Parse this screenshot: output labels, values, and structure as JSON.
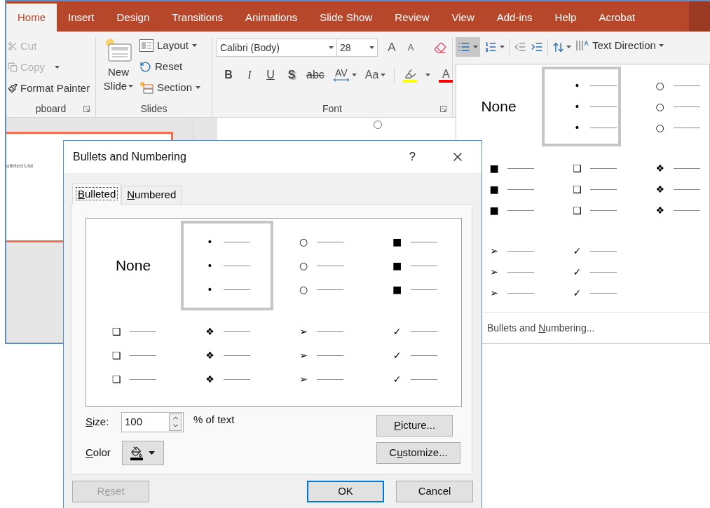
{
  "ribbon": {
    "tabs": [
      {
        "label": "Home",
        "selected": true
      },
      {
        "label": "Insert",
        "selected": false
      },
      {
        "label": "Design",
        "selected": false
      },
      {
        "label": "Transitions",
        "selected": false
      },
      {
        "label": "Animations",
        "selected": false
      },
      {
        "label": "Slide Show",
        "selected": false
      },
      {
        "label": "Review",
        "selected": false
      },
      {
        "label": "View",
        "selected": false
      },
      {
        "label": "Add-ins",
        "selected": false
      },
      {
        "label": "Help",
        "selected": false
      },
      {
        "label": "Acrobat",
        "selected": false
      }
    ],
    "clipboard": {
      "label": "pboard",
      "items": [
        {
          "label": "Cut",
          "kind": "cut",
          "disabled": true,
          "dropdown": false
        },
        {
          "label": "Copy",
          "kind": "copy",
          "disabled": true,
          "dropdown": true
        },
        {
          "label": "Format Painter",
          "kind": "painter",
          "disabled": false,
          "dropdown": false
        }
      ]
    },
    "slides": {
      "label": "Slides",
      "new_slide": [
        "New",
        "Slide"
      ],
      "items": [
        {
          "label": "Layout",
          "kind": "layout",
          "dropdown": true
        },
        {
          "label": "Reset",
          "kind": "reset",
          "dropdown": false
        },
        {
          "label": "Section",
          "kind": "section",
          "dropdown": true
        }
      ]
    },
    "font": {
      "label": "Font",
      "font_name": "Calibri (Body)",
      "font_size": "28",
      "grow": "A",
      "shrink": "A",
      "styles": [
        {
          "label": "B",
          "kind": "bold"
        },
        {
          "label": "I",
          "kind": "italic"
        },
        {
          "label": "U",
          "kind": "underline"
        },
        {
          "label": "S",
          "kind": "shadow"
        },
        {
          "label": "abc",
          "kind": "strike"
        }
      ],
      "spacing": "AV",
      "case": "Aa",
      "font_color": "A"
    },
    "paragraph": {
      "bullets_selected": true,
      "text_direction": "Text Direction"
    }
  },
  "slide_thumbnail": {
    "text": "ulleted List"
  },
  "gallery": {
    "cells": [
      {
        "kind": "none",
        "label": "None",
        "selected": false
      },
      {
        "kind": "bullets",
        "symbol": "•",
        "selected": true
      },
      {
        "kind": "bullets",
        "symbol": "○",
        "selected": false
      },
      {
        "kind": "bullets",
        "symbol": "■",
        "selected": false
      },
      {
        "kind": "bullets",
        "symbol": "❑",
        "selected": false
      },
      {
        "kind": "bullets",
        "symbol": "❖",
        "selected": false
      },
      {
        "kind": "bullets",
        "symbol": "➢",
        "selected": false
      },
      {
        "kind": "bullets",
        "symbol": "✓",
        "selected": false
      }
    ],
    "footer": {
      "parts": [
        {
          "text": "Bullets and ",
          "underline": false
        },
        {
          "text": "N",
          "underline": true
        },
        {
          "text": "umbering...",
          "underline": false
        }
      ]
    }
  },
  "dialog": {
    "title": "Bullets and Numbering",
    "help": "?",
    "tabs": [
      {
        "parts": [
          {
            "text": "B",
            "underline": true
          },
          {
            "text": "ulleted",
            "underline": false
          }
        ],
        "selected": true
      },
      {
        "parts": [
          {
            "text": "N",
            "underline": true
          },
          {
            "text": "umbered",
            "underline": false
          }
        ],
        "selected": false
      }
    ],
    "cells": [
      {
        "kind": "none",
        "label": "None",
        "selected": false
      },
      {
        "kind": "bullets",
        "symbol": "•",
        "selected": true
      },
      {
        "kind": "bullets",
        "symbol": "○",
        "selected": false
      },
      {
        "kind": "bullets",
        "symbol": "■",
        "selected": false
      },
      {
        "kind": "bullets",
        "symbol": "❑",
        "selected": false
      },
      {
        "kind": "bullets",
        "symbol": "❖",
        "selected": false
      },
      {
        "kind": "bullets",
        "symbol": "➢",
        "selected": false
      },
      {
        "kind": "bullets",
        "symbol": "✓",
        "selected": false
      }
    ],
    "size": {
      "parts": [
        {
          "text": "S",
          "underline": true
        },
        {
          "text": "ize:",
          "underline": false
        }
      ],
      "value": "100",
      "suffix": "% of text"
    },
    "color": {
      "parts": [
        {
          "text": "C",
          "underline": true
        },
        {
          "text": "olor",
          "underline": false
        }
      ]
    },
    "side_buttons": [
      {
        "parts": [
          {
            "text": "P",
            "underline": true
          },
          {
            "text": "icture...",
            "underline": false
          }
        ]
      },
      {
        "parts": [
          {
            "text": "C",
            "underline": false
          },
          {
            "text": "u",
            "underline": true
          },
          {
            "text": "stomize...",
            "underline": false
          }
        ]
      }
    ],
    "buttons": [
      {
        "parts": [
          {
            "text": "R",
            "underline": false
          },
          {
            "text": "e",
            "underline": true
          },
          {
            "text": "set",
            "underline": false
          }
        ],
        "disabled": true,
        "default": false
      },
      {
        "parts": [
          {
            "text": "OK",
            "underline": false
          }
        ],
        "disabled": false,
        "default": true
      },
      {
        "parts": [
          {
            "text": "Cancel",
            "underline": false
          }
        ],
        "disabled": false,
        "default": false
      }
    ]
  }
}
